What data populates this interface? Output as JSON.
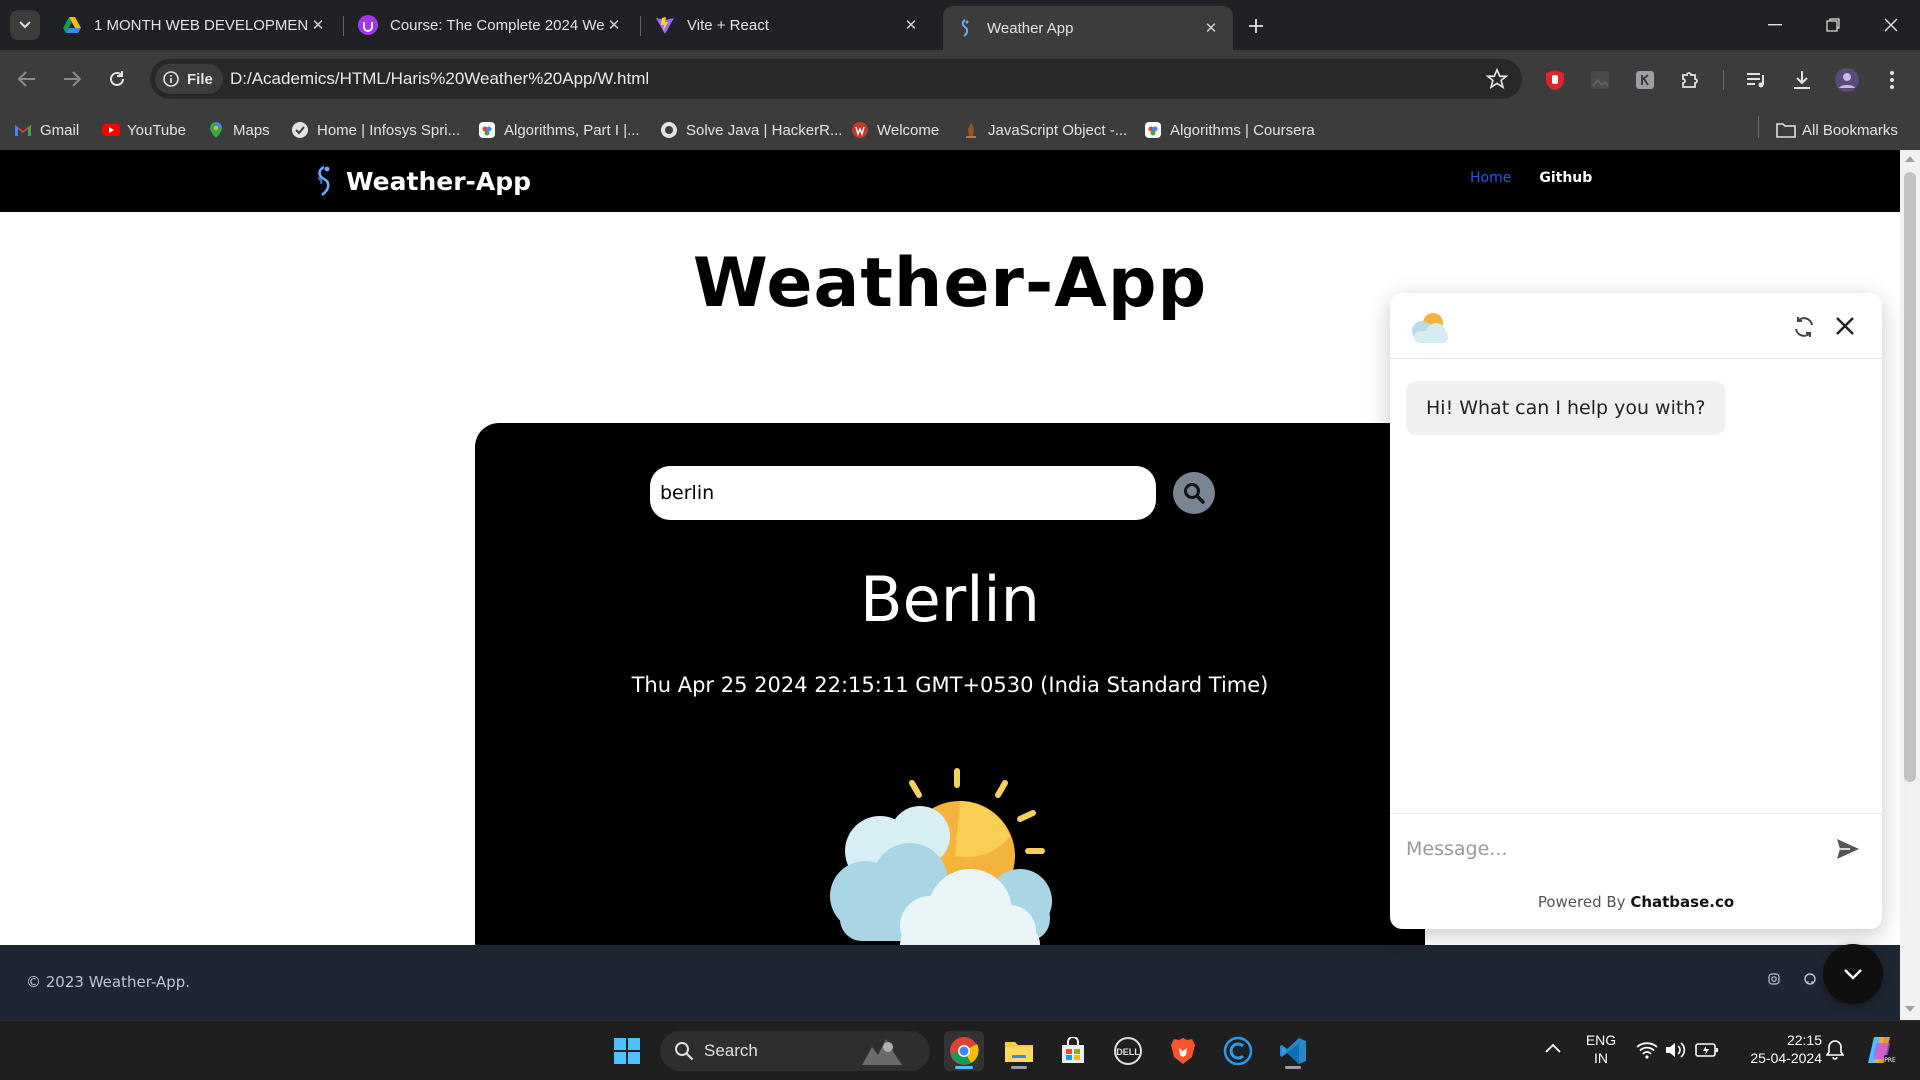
{
  "browser": {
    "tabs": [
      {
        "title": "1 MONTH WEB DEVELOPMENT",
        "favicon": "google-drive-icon",
        "active": false
      },
      {
        "title": "Course: The Complete 2024 We",
        "favicon": "udemy-icon",
        "active": false
      },
      {
        "title": "Vite + React",
        "favicon": "vite-icon",
        "active": false
      },
      {
        "title": "Weather App",
        "favicon": "weather-app-icon",
        "active": true
      }
    ],
    "site_chip": "File",
    "url": "D:/Academics/HTML/Haris%20Weather%20App/W.html",
    "bookmarks": [
      {
        "label": "Gmail",
        "icon": "gmail-icon"
      },
      {
        "label": "YouTube",
        "icon": "youtube-icon"
      },
      {
        "label": "Maps",
        "icon": "maps-icon"
      },
      {
        "label": "Home | Infosys Spri...",
        "icon": "infosys-icon"
      },
      {
        "label": "Algorithms, Part I |...",
        "icon": "coursera-icon"
      },
      {
        "label": "Solve Java | HackerR...",
        "icon": "hackerrank-icon"
      },
      {
        "label": "Welcome",
        "icon": "welcome-icon"
      },
      {
        "label": "JavaScript Object -...",
        "icon": "js-object-icon"
      },
      {
        "label": "Algorithms | Coursera",
        "icon": "coursera-icon"
      }
    ],
    "all_bookmarks": "All Bookmarks"
  },
  "site": {
    "brand": "Weather-App",
    "nav": {
      "home": "Home",
      "github": "Github"
    },
    "title": "Weather-App",
    "search": {
      "value": "berlin",
      "placeholder": ""
    },
    "city": "Berlin",
    "datetime": "Thu Apr 25 2024 22:15:11 GMT+0530 (India Standard Time)",
    "weather_icon": "partly-cloudy-sun-icon",
    "footer": "© 2023 Weather-App."
  },
  "chat": {
    "greeting": "Hi! What can I help you with?",
    "input_placeholder": "Message...",
    "powered_by": "Powered By",
    "powered_brand": "Chatbase.co"
  },
  "taskbar": {
    "search": "Search",
    "lang_line1": "ENG",
    "lang_line2": "IN",
    "time": "22:15",
    "date": "25-04-2024"
  },
  "colors": {
    "nav_bg": "#000000",
    "card_bg": "#000000",
    "footer_bg": "#1f2633",
    "home_link": "#1e5bf0",
    "search_button": "#7a8594"
  }
}
